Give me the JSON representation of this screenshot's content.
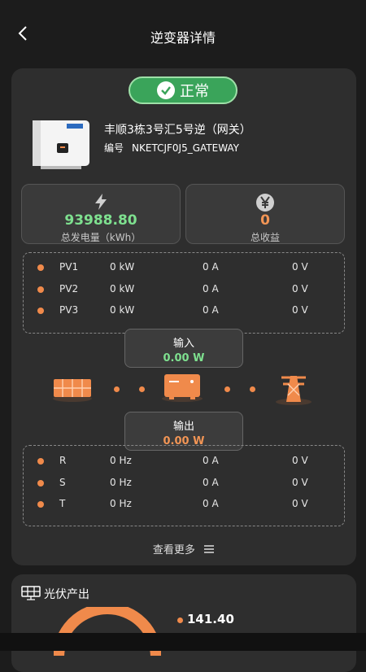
{
  "header": {
    "title": "逆变器详情"
  },
  "status": {
    "label": "正常",
    "color": "#3aa45a"
  },
  "device": {
    "name": "丰顺3栋3号汇5号逆（网关）",
    "code_label": "编号",
    "code_value": "NKETCJF0J5_GATEWAY"
  },
  "stats": {
    "energy": {
      "value": "93988.80",
      "label": "总发电量（kWh）",
      "color": "#7ee08f"
    },
    "income": {
      "value": "0",
      "label": "总收益",
      "color": "#f29555"
    }
  },
  "pv_rows": [
    {
      "name": "PV1",
      "power": "0 kW",
      "current": "0 A",
      "voltage": "0 V"
    },
    {
      "name": "PV2",
      "power": "0 kW",
      "current": "0 A",
      "voltage": "0 V"
    },
    {
      "name": "PV3",
      "power": "0 kW",
      "current": "0 A",
      "voltage": "0 V"
    }
  ],
  "input": {
    "label": "输入",
    "value": "0.00 W",
    "color": "#7ee08f"
  },
  "output": {
    "label": "输出",
    "value": "0.00 W",
    "color": "#f29555"
  },
  "phase_rows": [
    {
      "name": "R",
      "freq": "0 Hz",
      "current": "0 A",
      "voltage": "0 V"
    },
    {
      "name": "S",
      "freq": "0 Hz",
      "current": "0 A",
      "voltage": "0 V"
    },
    {
      "name": "T",
      "freq": "0 Hz",
      "current": "0 A",
      "voltage": "0 V"
    }
  ],
  "more": {
    "label": "查看更多"
  },
  "pv_output": {
    "title": "光伏产出",
    "value": "141.40"
  },
  "accent": "#f08a4b"
}
